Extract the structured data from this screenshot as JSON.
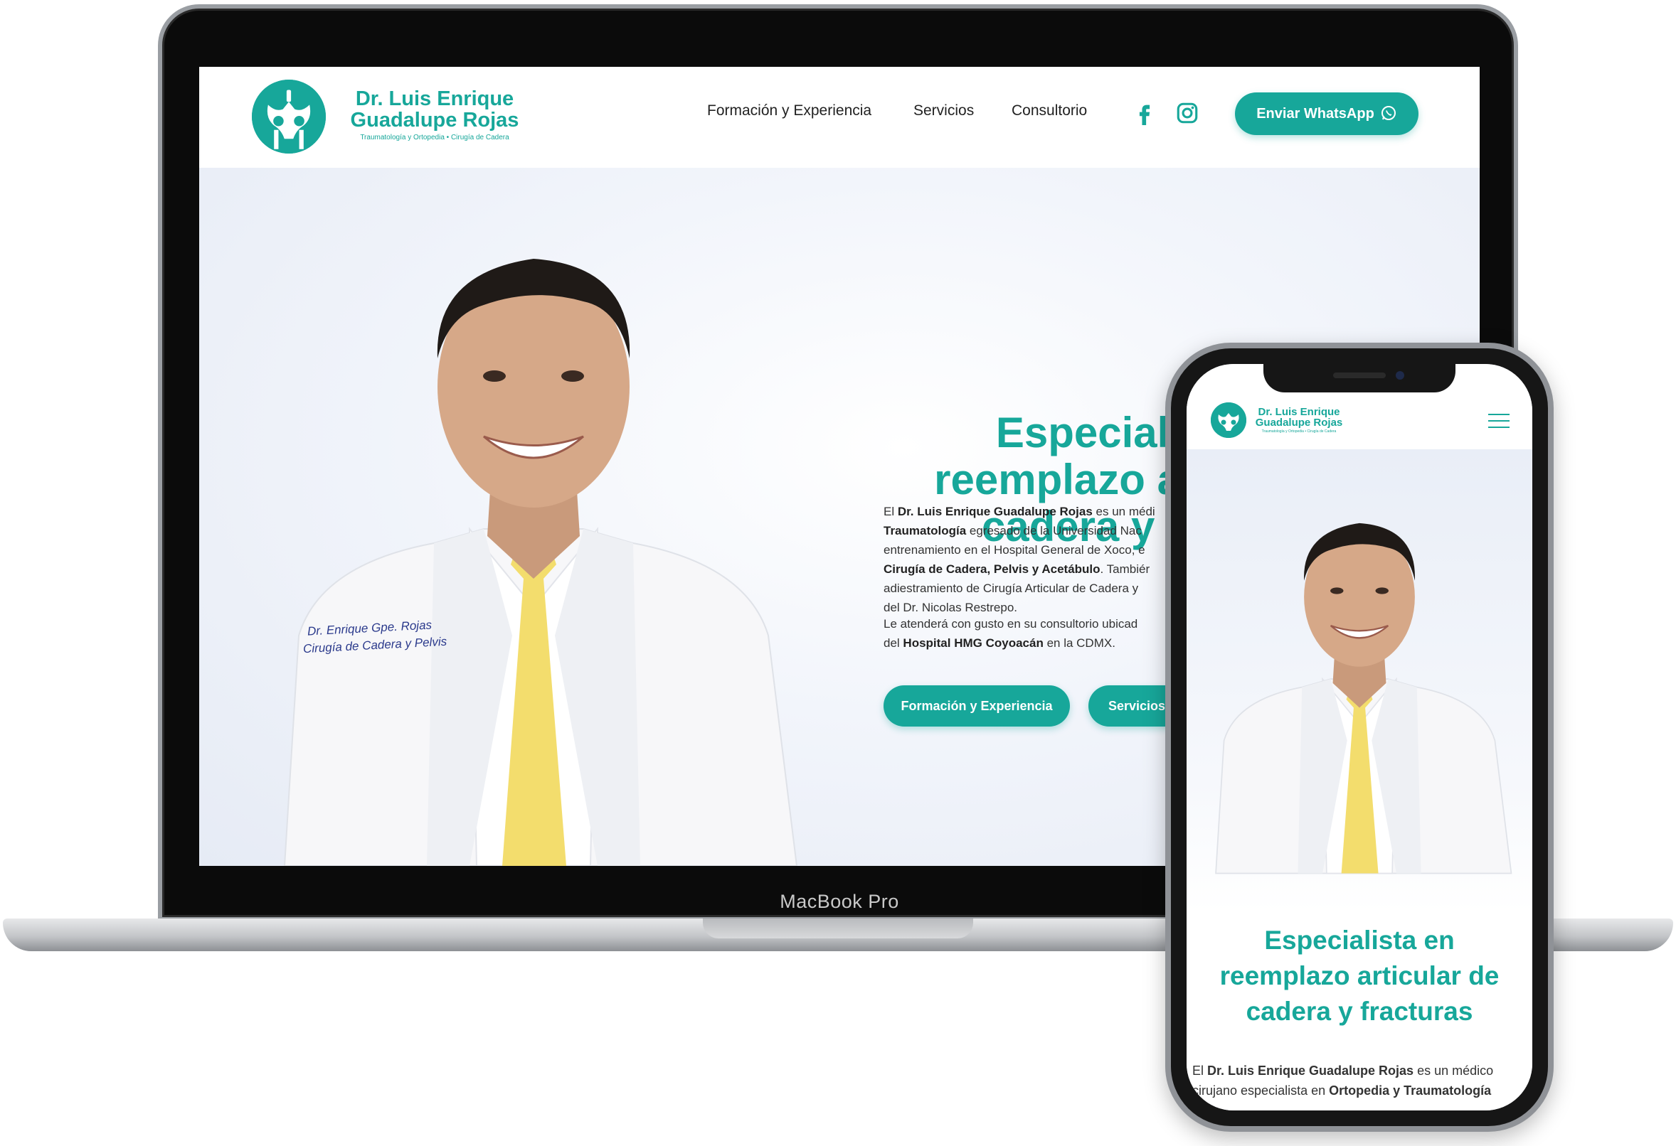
{
  "device_labels": {
    "laptop": "MacBook Pro"
  },
  "brand": {
    "name_line1": "Dr. Luis Enrique",
    "name_line2": "Guadalupe Rojas",
    "tagline": "Traumatología y Ortopedia • Cirugía de Cadera",
    "accent_color": "#17a79a"
  },
  "desktop": {
    "nav": {
      "items": [
        {
          "label": "Formación y Experiencia"
        },
        {
          "label": "Servicios"
        },
        {
          "label": "Consultorio"
        }
      ],
      "social": [
        {
          "icon": "facebook-icon"
        },
        {
          "icon": "instagram-icon"
        }
      ],
      "whatsapp_button": "Enviar WhatsApp"
    },
    "hero": {
      "title_line1": "Especiali",
      "title_line2": "reemplazo a",
      "title_line3": "cadera y f",
      "para1": {
        "l1_pre": "El ",
        "l1_bold": "Dr. Luis Enrique Guadalupe Rojas",
        "l1_post": " es un médi",
        "l2_bold": "Traumatología",
        "l2_post": " egresado de la Universidad Nac",
        "l3": "entrenamiento en el Hospital General de Xoco, e",
        "l4_bold": "Cirugía de Cadera, Pelvis y Acetábulo",
        "l4_post": ". Tambiér",
        "l5": "adiestramiento de Cirugía Articular de Cadera y",
        "l6": "del Dr. Nicolas Restrepo."
      },
      "para2": {
        "l1": "Le atenderá con gusto en su consultorio ubicad",
        "l2_pre": "del ",
        "l2_bold": "Hospital HMG Coyoacán",
        "l2_post": " en la CDMX."
      },
      "cta_primary": "Formación y Experiencia",
      "cta_secondary": "Servicios",
      "coat_embroidery_line1": "Dr. Enrique  Gpe. Rojas",
      "coat_embroidery_line2": "Cirugía de Cadera y Pelvis"
    }
  },
  "mobile": {
    "menu_icon": "hamburger-menu-icon",
    "hero": {
      "title_line1": "Especialista en",
      "title_line2": "reemplazo articular de",
      "title_line3": "cadera y fracturas",
      "para": {
        "l1_pre": "El ",
        "l1_bold": "Dr. Luis Enrique Guadalupe Rojas",
        "l1_post": " es un médico",
        "l2_pre": "cirujano especialista en ",
        "l2_bold": "Ortopedia y Traumatología"
      }
    }
  }
}
